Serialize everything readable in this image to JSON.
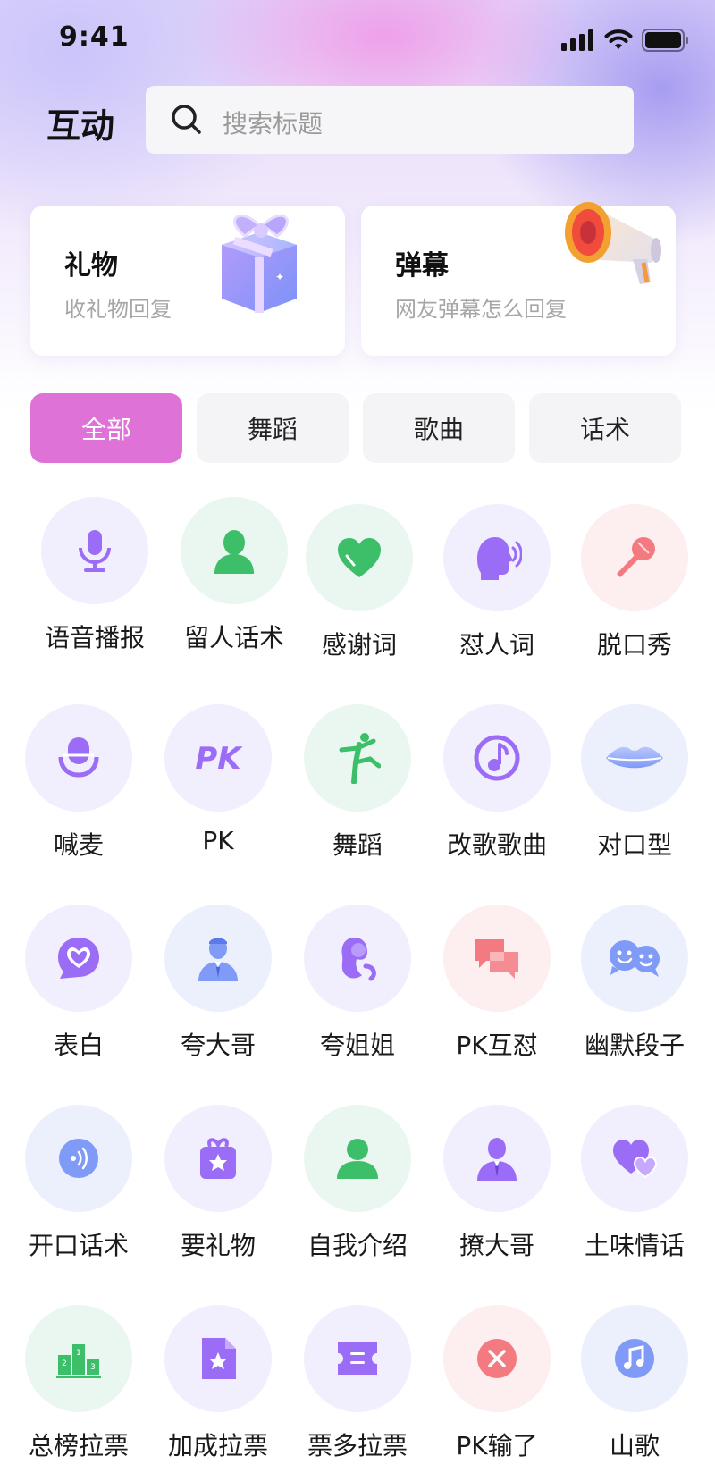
{
  "status_bar": {
    "time": "9:41"
  },
  "header": {
    "title": "互动",
    "search_placeholder": "搜索标题"
  },
  "cards": [
    {
      "title": "礼物",
      "subtitle": "收礼物回复",
      "icon": "gift-box-icon"
    },
    {
      "title": "弹幕",
      "subtitle": "网友弹幕怎么回复",
      "icon": "megaphone-icon"
    }
  ],
  "tabs": [
    {
      "label": "全部",
      "active": true
    },
    {
      "label": "舞蹈",
      "active": false
    },
    {
      "label": "歌曲",
      "active": false
    },
    {
      "label": "话术",
      "active": false
    }
  ],
  "items": [
    {
      "label": "语音播报",
      "icon": "microphone-icon"
    },
    {
      "label": "留人话术",
      "icon": "person-icon"
    },
    {
      "label": "感谢词",
      "icon": "heart-icon"
    },
    {
      "label": "怼人词",
      "icon": "speaking-head-icon"
    },
    {
      "label": "脱口秀",
      "icon": "handheld-mic-icon"
    },
    {
      "label": "喊麦",
      "icon": "podcast-mic-icon"
    },
    {
      "label": "PK",
      "icon": "pk-icon"
    },
    {
      "label": "舞蹈",
      "icon": "dancer-icon"
    },
    {
      "label": "改歌歌曲",
      "icon": "music-note-circle-icon"
    },
    {
      "label": "对口型",
      "icon": "lips-icon"
    },
    {
      "label": "表白",
      "icon": "heart-bubble-icon"
    },
    {
      "label": "夸大哥",
      "icon": "man-in-suit-icon"
    },
    {
      "label": "夸姐姐",
      "icon": "woman-icon"
    },
    {
      "label": "PK互怼",
      "icon": "chat-bubbles-icon"
    },
    {
      "label": "幽默段子",
      "icon": "smiley-bubbles-icon"
    },
    {
      "label": "开口话术",
      "icon": "sound-wave-icon"
    },
    {
      "label": "要礼物",
      "icon": "gift-bag-icon"
    },
    {
      "label": "自我介绍",
      "icon": "user-icon"
    },
    {
      "label": "撩大哥",
      "icon": "gentleman-icon"
    },
    {
      "label": "土味情话",
      "icon": "double-heart-icon"
    },
    {
      "label": "总榜拉票",
      "icon": "podium-icon"
    },
    {
      "label": "加成拉票",
      "icon": "star-document-icon"
    },
    {
      "label": "票多拉票",
      "icon": "ticket-icon"
    },
    {
      "label": "PK输了",
      "icon": "close-circle-icon"
    },
    {
      "label": "山歌",
      "icon": "music-note-icon"
    }
  ],
  "colors": {
    "accent": "#df72d6",
    "purple": "#9b6cf5",
    "green": "#3dbf6a",
    "pink": "#f47a82",
    "blue": "#7f9af7"
  }
}
